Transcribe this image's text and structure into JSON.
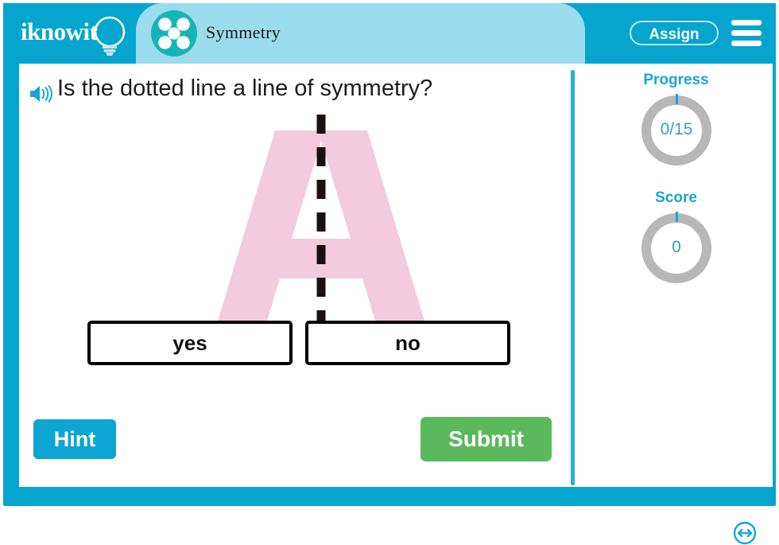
{
  "header": {
    "logo_text": "iknowit",
    "logo_icon": "lightbulb-icon",
    "topic_title": "Symmetry",
    "topic_icon": "five-dots-circle-icon",
    "assign_label": "Assign",
    "menu_icon": "hamburger-menu-icon",
    "bar_color": "#06A5CE",
    "tab_color": "#9BDCEE"
  },
  "question": {
    "speaker_icon": "speaker-audio-icon",
    "text": "Is the dotted line a line of symmetry?",
    "figure": {
      "letter": "A",
      "letter_color": "#F2CBDD",
      "symmetry_line": "vertical-dashed-line",
      "line_color": "#1A1010"
    }
  },
  "choices": [
    {
      "label": "yes",
      "value": "yes"
    },
    {
      "label": "no",
      "value": "no"
    }
  ],
  "actions": {
    "hint_label": "Hint",
    "hint_color": "#0CA5D4",
    "submit_label": "Submit",
    "submit_color": "#5CB85C"
  },
  "right_rail": {
    "progress_label": "Progress",
    "progress_value": "0/15",
    "score_label": "Score",
    "score_value": "0",
    "ring_color": "#B7B7B7",
    "accent_color": "#1BA3D6"
  },
  "footer": {
    "resize_icon": "resize-horizontal-icon"
  }
}
